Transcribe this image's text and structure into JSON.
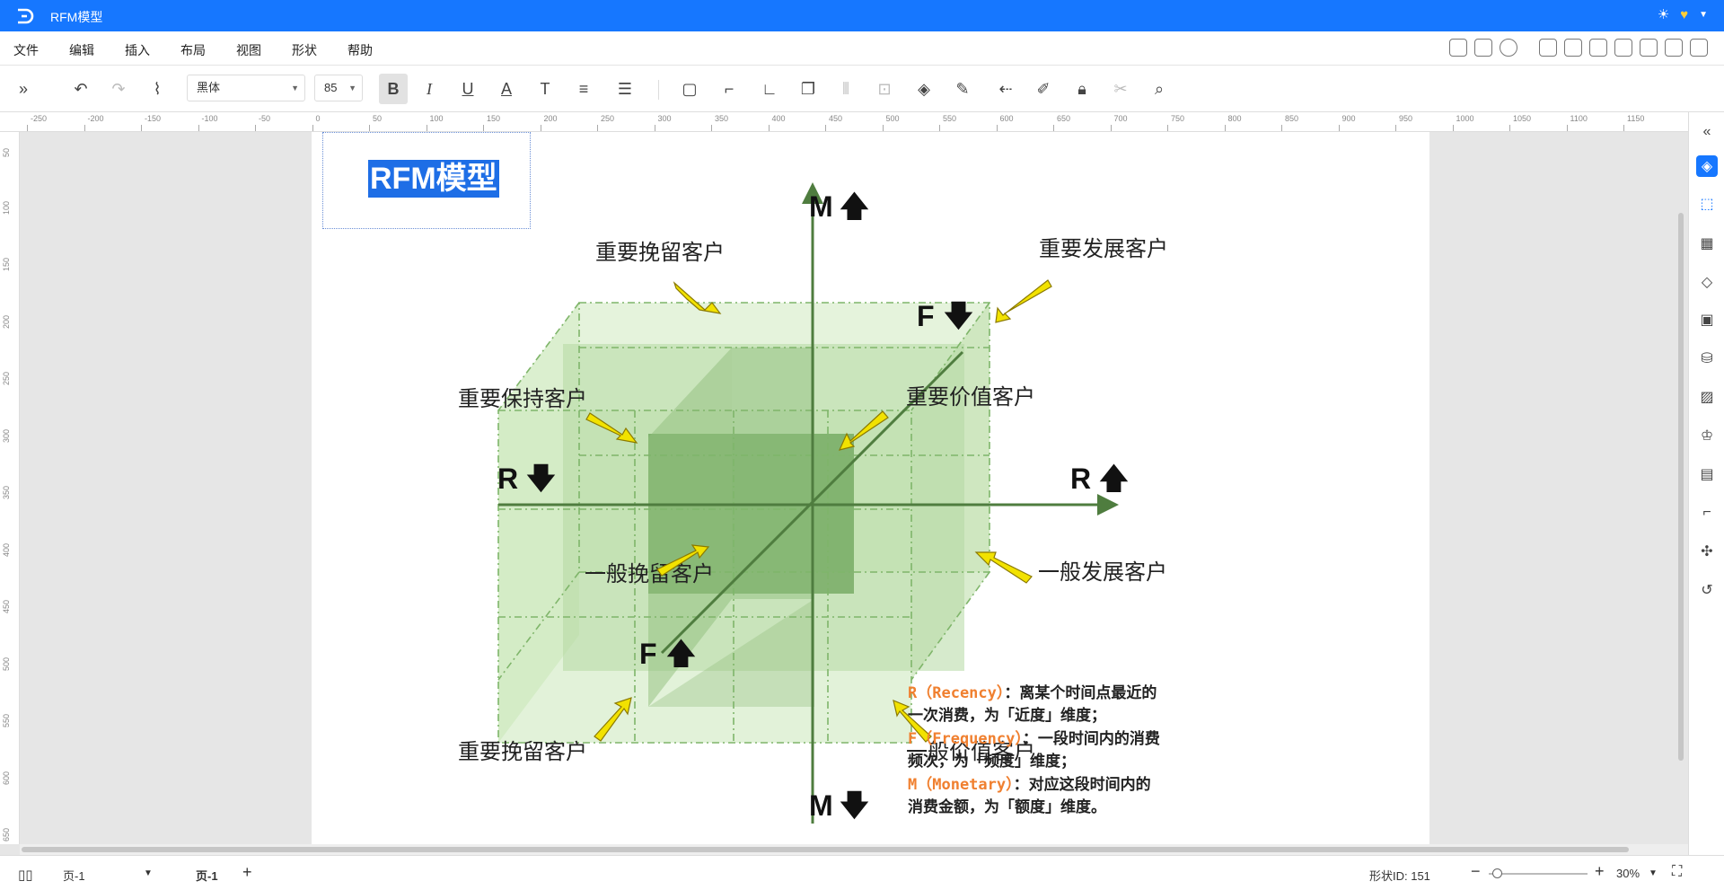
{
  "titlebar": {
    "title": "RFM模型"
  },
  "menu": {
    "items": [
      "文件",
      "编辑",
      "插入",
      "布局",
      "视图",
      "形状",
      "帮助"
    ]
  },
  "toolbar": {
    "font_family": "黑体",
    "font_size": "85"
  },
  "ruler_top": [
    "-250",
    "-200",
    "-150",
    "-100",
    "-50",
    "0",
    "50",
    "100",
    "150",
    "200",
    "250",
    "300",
    "350",
    "400",
    "450",
    "500",
    "550",
    "600",
    "650",
    "700",
    "750",
    "800",
    "850",
    "900",
    "950",
    "1000",
    "1050",
    "1100",
    "1150"
  ],
  "ruler_left": [
    "50",
    "100",
    "150",
    "200",
    "250",
    "300",
    "350",
    "400",
    "450",
    "500",
    "550",
    "600",
    "650"
  ],
  "diagram": {
    "title": "RFM模型",
    "axis_labels": {
      "m_up": "M",
      "m_down": "M",
      "r_left": "R",
      "r_right": "R",
      "f_top": "F",
      "f_bottom": "F"
    },
    "segments": {
      "top_left_back": "重要挽留客户",
      "top_right_back": "重要发展客户",
      "mid_left": "重要保持客户",
      "center": "重要价值客户",
      "low_left_inner": "一般挽留客户",
      "low_right": "一般发展客户",
      "bottom_left": "重要挽留客户",
      "bottom_right": "一般价值客户"
    },
    "legend": {
      "r_key": "R（Recency）",
      "r_text1": "：离某个时间点最近的",
      "r_text2": "一次消费，为「近度」维度；",
      "f_key": "F（Frequency）",
      "f_text1": "：一段时间内的消费",
      "f_text2": "频次，为「频度」维度；",
      "m_key": "M（Monetary）",
      "m_text1": "：对应这段时间内的",
      "m_text2": "消费金额，为「额度」维度。"
    },
    "colors": {
      "cube_light": "#cfeabf",
      "cube_mid": "#9cc78a",
      "cube_dark": "#6ca45a",
      "axis": "#4f7d3f",
      "arrow": "#f2e200",
      "legend_key": "#f08030"
    }
  },
  "statusbar": {
    "page_select": "页-1",
    "page_tab": "页-1",
    "shape_id": "形状ID: 151",
    "zoom": "30%"
  }
}
